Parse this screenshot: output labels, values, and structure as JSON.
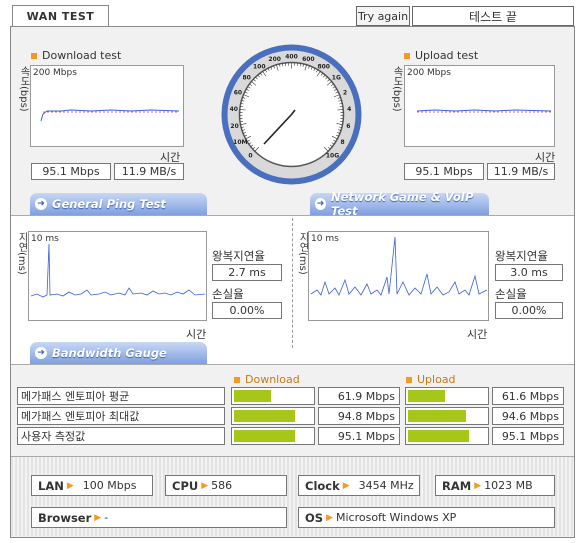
{
  "title": "WAN TEST",
  "try_again": "Try again",
  "status": "테스트 끝",
  "download": {
    "title": "Download test",
    "axis_y": "속도(bps)",
    "axis_x": "시간",
    "max": "200 Mbps",
    "mbps": "95.1 Mbps",
    "mbs": "11.9 MB/s"
  },
  "upload": {
    "title": "Upload test",
    "axis_y": "속도(bps)",
    "axis_x": "시간",
    "max": "200 Mbps",
    "mbps": "95.1 Mbps",
    "mbs": "11.9 MB/s"
  },
  "gauge": {
    "labels": [
      "0",
      "10M",
      "20",
      "40",
      "60",
      "80",
      "100",
      "200",
      "400",
      "600",
      "800",
      "1G",
      "2",
      "4",
      "6",
      "8",
      "10G"
    ],
    "needle_value": "95.1 Mbps"
  },
  "tabs": {
    "ping": "General Ping Test",
    "game": "Network Game & VoIP Test",
    "bandwidth": "Bandwidth Gauge"
  },
  "ping": {
    "axis_y": "지연(ms)",
    "axis_x": "시간",
    "max": "10 ms",
    "rtt_label": "왕복지연율",
    "rtt": "2.7 ms",
    "loss_label": "손실율",
    "loss": "0.00%"
  },
  "game": {
    "axis_y": "지연(ms)",
    "axis_x": "시간",
    "max": "10 ms",
    "rtt_label": "왕복지연율",
    "rtt": "3.0 ms",
    "loss_label": "손실율",
    "loss": "0.00%"
  },
  "bandwidth": {
    "download_header": "Download",
    "upload_header": "Upload",
    "rows": [
      {
        "label": "메가패스 엔토피아 평균",
        "down": "61.9 Mbps",
        "down_pct": 0.47,
        "up": "61.6 Mbps",
        "up_pct": 0.47
      },
      {
        "label": "메가패스 엔토피아 최대값",
        "down": "94.8 Mbps",
        "down_pct": 0.78,
        "up": "94.6 Mbps",
        "up_pct": 0.74
      },
      {
        "label": "사용자 측정값",
        "down": "95.1 Mbps",
        "down_pct": 0.78,
        "up": "95.1 Mbps",
        "up_pct": 0.78
      }
    ]
  },
  "system": {
    "lan_label": "LAN",
    "lan": "100 Mbps",
    "cpu_label": "CPU",
    "cpu": "586",
    "clock_label": "Clock",
    "clock": "3454 MHz",
    "ram_label": "RAM",
    "ram": "1023 MB",
    "browser_label": "Browser",
    "browser": "-",
    "os_label": "OS",
    "os": "Microsoft Windows XP"
  },
  "colors": {
    "accent": "#f39a1f",
    "tab_blue": "#7f9fe0",
    "bar_green": "#a6c61a",
    "trace_blue": "#3b5fd9"
  }
}
